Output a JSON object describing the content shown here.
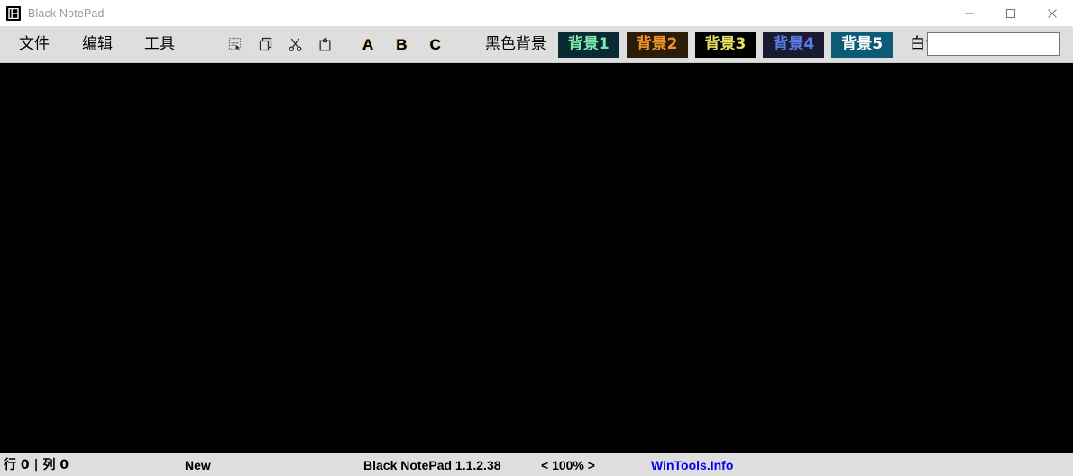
{
  "window": {
    "title": "Black NotePad",
    "icon": "app-b-logo-icon",
    "controls": {
      "minimize": "minimize-icon",
      "maximize": "maximize-icon",
      "close": "close-icon"
    }
  },
  "menu": {
    "file": "文件",
    "edit": "编辑",
    "tools": "工具"
  },
  "toolbar": {
    "icons": [
      {
        "name": "select-all-icon",
        "title": "select-all"
      },
      {
        "name": "copy-icon",
        "title": "copy"
      },
      {
        "name": "cut-icon",
        "title": "cut"
      },
      {
        "name": "paste-icon",
        "title": "paste"
      }
    ],
    "font_buttons": [
      {
        "label": "A",
        "name": "font-a-button"
      },
      {
        "label": "B",
        "name": "font-b-button"
      },
      {
        "label": "C",
        "name": "font-c-button"
      }
    ],
    "backgrounds": [
      {
        "label": "黑色背景",
        "name": "bg-black-button",
        "bg": "transparent",
        "fg": "#000000",
        "style": "plain"
      },
      {
        "label": "背景1",
        "name": "bg-1-button",
        "bg": "#0a2b33",
        "fg": "#7de8a8",
        "style": "swatch"
      },
      {
        "label": "背景2",
        "name": "bg-2-button",
        "bg": "#2b1d09",
        "fg": "#f0932b",
        "style": "swatch"
      },
      {
        "label": "背景3",
        "name": "bg-3-button",
        "bg": "#000000",
        "fg": "#e8e060",
        "style": "swatch"
      },
      {
        "label": "背景4",
        "name": "bg-4-button",
        "bg": "#1a1a33",
        "fg": "#5b7de8",
        "style": "swatch"
      },
      {
        "label": "背景5",
        "name": "bg-5-button",
        "bg": "#0d5a77",
        "fg": "#ffffff",
        "style": "swatch"
      },
      {
        "label": "白色背景",
        "name": "bg-white-button",
        "bg": "transparent",
        "fg": "#000000",
        "style": "plain"
      }
    ],
    "search": {
      "value": "",
      "placeholder": ""
    }
  },
  "editor": {
    "content": "",
    "background": "#000000",
    "foreground": "#ffffff"
  },
  "statusbar": {
    "line_col": "行 0 | 列 0",
    "document": "New",
    "version": "Black NotePad 1.1.2.38",
    "zoom": "< 100% >",
    "link": "WinTools.Info",
    "link_color": "#0000ee"
  }
}
